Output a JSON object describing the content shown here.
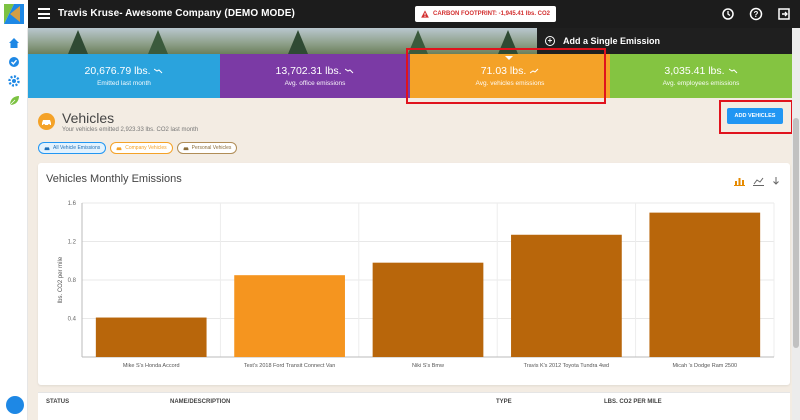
{
  "app": {
    "title": "Travis Kruse- Awesome Company (DEMO MODE)",
    "carbon_footprint": "CARBON FOOTPRINT: -1,945.41 lbs. CO2"
  },
  "colors": {
    "topbar": "#1c1c1c",
    "stat_blue": "#2aa3dd",
    "stat_purple": "#7b3aa5",
    "stat_orange": "#f4a228",
    "stat_green": "#84c441",
    "bar_brown": "#b8660b",
    "bar_orange": "#f5951f",
    "highlight_red": "#e0131d",
    "primary_button": "#2196f3"
  },
  "sidenav": {
    "icons": [
      "home-icon",
      "check-badge-icon",
      "gear-icon",
      "leaf-icon"
    ]
  },
  "top_icons": [
    "history-icon",
    "help-icon",
    "logout-icon"
  ],
  "add_single_emission": "Add a Single Emission",
  "stats": [
    {
      "value": "20,676.79 lbs.",
      "label": "Emitted last month",
      "trend": "down"
    },
    {
      "value": "13,702.31 lbs.",
      "label": "Avg. office emissions",
      "trend": "down"
    },
    {
      "value": "71.03 lbs.",
      "label": "Avg. vehicles emissions",
      "trend": "up"
    },
    {
      "value": "3,035.41 lbs.",
      "label": "Avg. employees emissions",
      "trend": "down"
    }
  ],
  "section": {
    "title": "Vehicles",
    "subtitle": "Your vehicles emitted 2,923.33 lbs. CO2 last month",
    "add_button": "ADD VEHICLES"
  },
  "filters": [
    {
      "label": "All Vehicle Emissions",
      "active": true
    },
    {
      "label": "Company Vehicles",
      "active": false
    },
    {
      "label": "Personal Vehicles",
      "active": false
    }
  ],
  "card": {
    "title": "Vehicles Monthly Emissions"
  },
  "chart_data": {
    "type": "bar",
    "categories": [
      "Mike S's Honda Accord",
      "Test's 2018 Ford Transit Connect Van",
      "Niki S's Bmw",
      "Travis K's 2012 Toyota Tundra 4wd",
      "Micah 's Dodge Ram 2500"
    ],
    "values": [
      0.41,
      0.85,
      0.98,
      1.27,
      1.5
    ],
    "bar_colors": [
      "#b8660b",
      "#f5951f",
      "#b8660b",
      "#b8660b",
      "#b8660b"
    ],
    "ylabel": "lbs. CO2 per mile",
    "ylim": [
      0,
      1.6
    ],
    "yticks": [
      "0.4",
      "0.8",
      "1.2",
      "1.6"
    ],
    "grid": true
  },
  "table": {
    "headers": [
      "STATUS",
      "NAME/DESCRIPTION",
      "TYPE",
      "LBS. CO2 PER MILE"
    ]
  }
}
